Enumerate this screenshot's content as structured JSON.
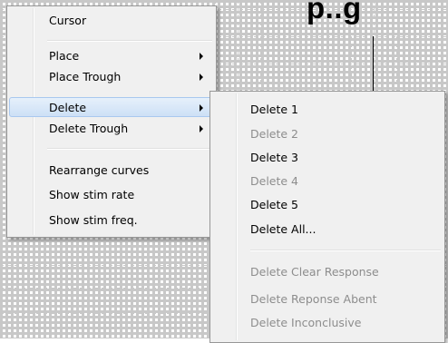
{
  "heading": "p..g",
  "context_menu": {
    "items": [
      {
        "label": "Cursor"
      },
      {
        "label": "Place"
      },
      {
        "label": "Place Trough"
      },
      {
        "label": "Delete"
      },
      {
        "label": "Delete Trough"
      },
      {
        "label": "Rearrange curves"
      },
      {
        "label": "Show stim rate"
      },
      {
        "label": "Show stim freq."
      }
    ]
  },
  "delete_submenu": {
    "items": [
      {
        "label": "Delete 1",
        "enabled": true
      },
      {
        "label": "Delete 2",
        "enabled": false
      },
      {
        "label": "Delete 3",
        "enabled": true
      },
      {
        "label": "Delete 4",
        "enabled": false
      },
      {
        "label": "Delete 5",
        "enabled": true
      },
      {
        "label": "Delete All...",
        "enabled": true
      },
      {
        "label": "Delete Clear Response",
        "enabled": false
      },
      {
        "label": "Delete Reponse Abent",
        "enabled": false
      },
      {
        "label": "Delete Inconclusive",
        "enabled": false
      }
    ]
  },
  "colors": {
    "menu_bg": "#f0f0f0",
    "highlight": "#cde0f6",
    "disabled_text": "#8d8d8d",
    "grid_line": "#c8c8c8"
  }
}
